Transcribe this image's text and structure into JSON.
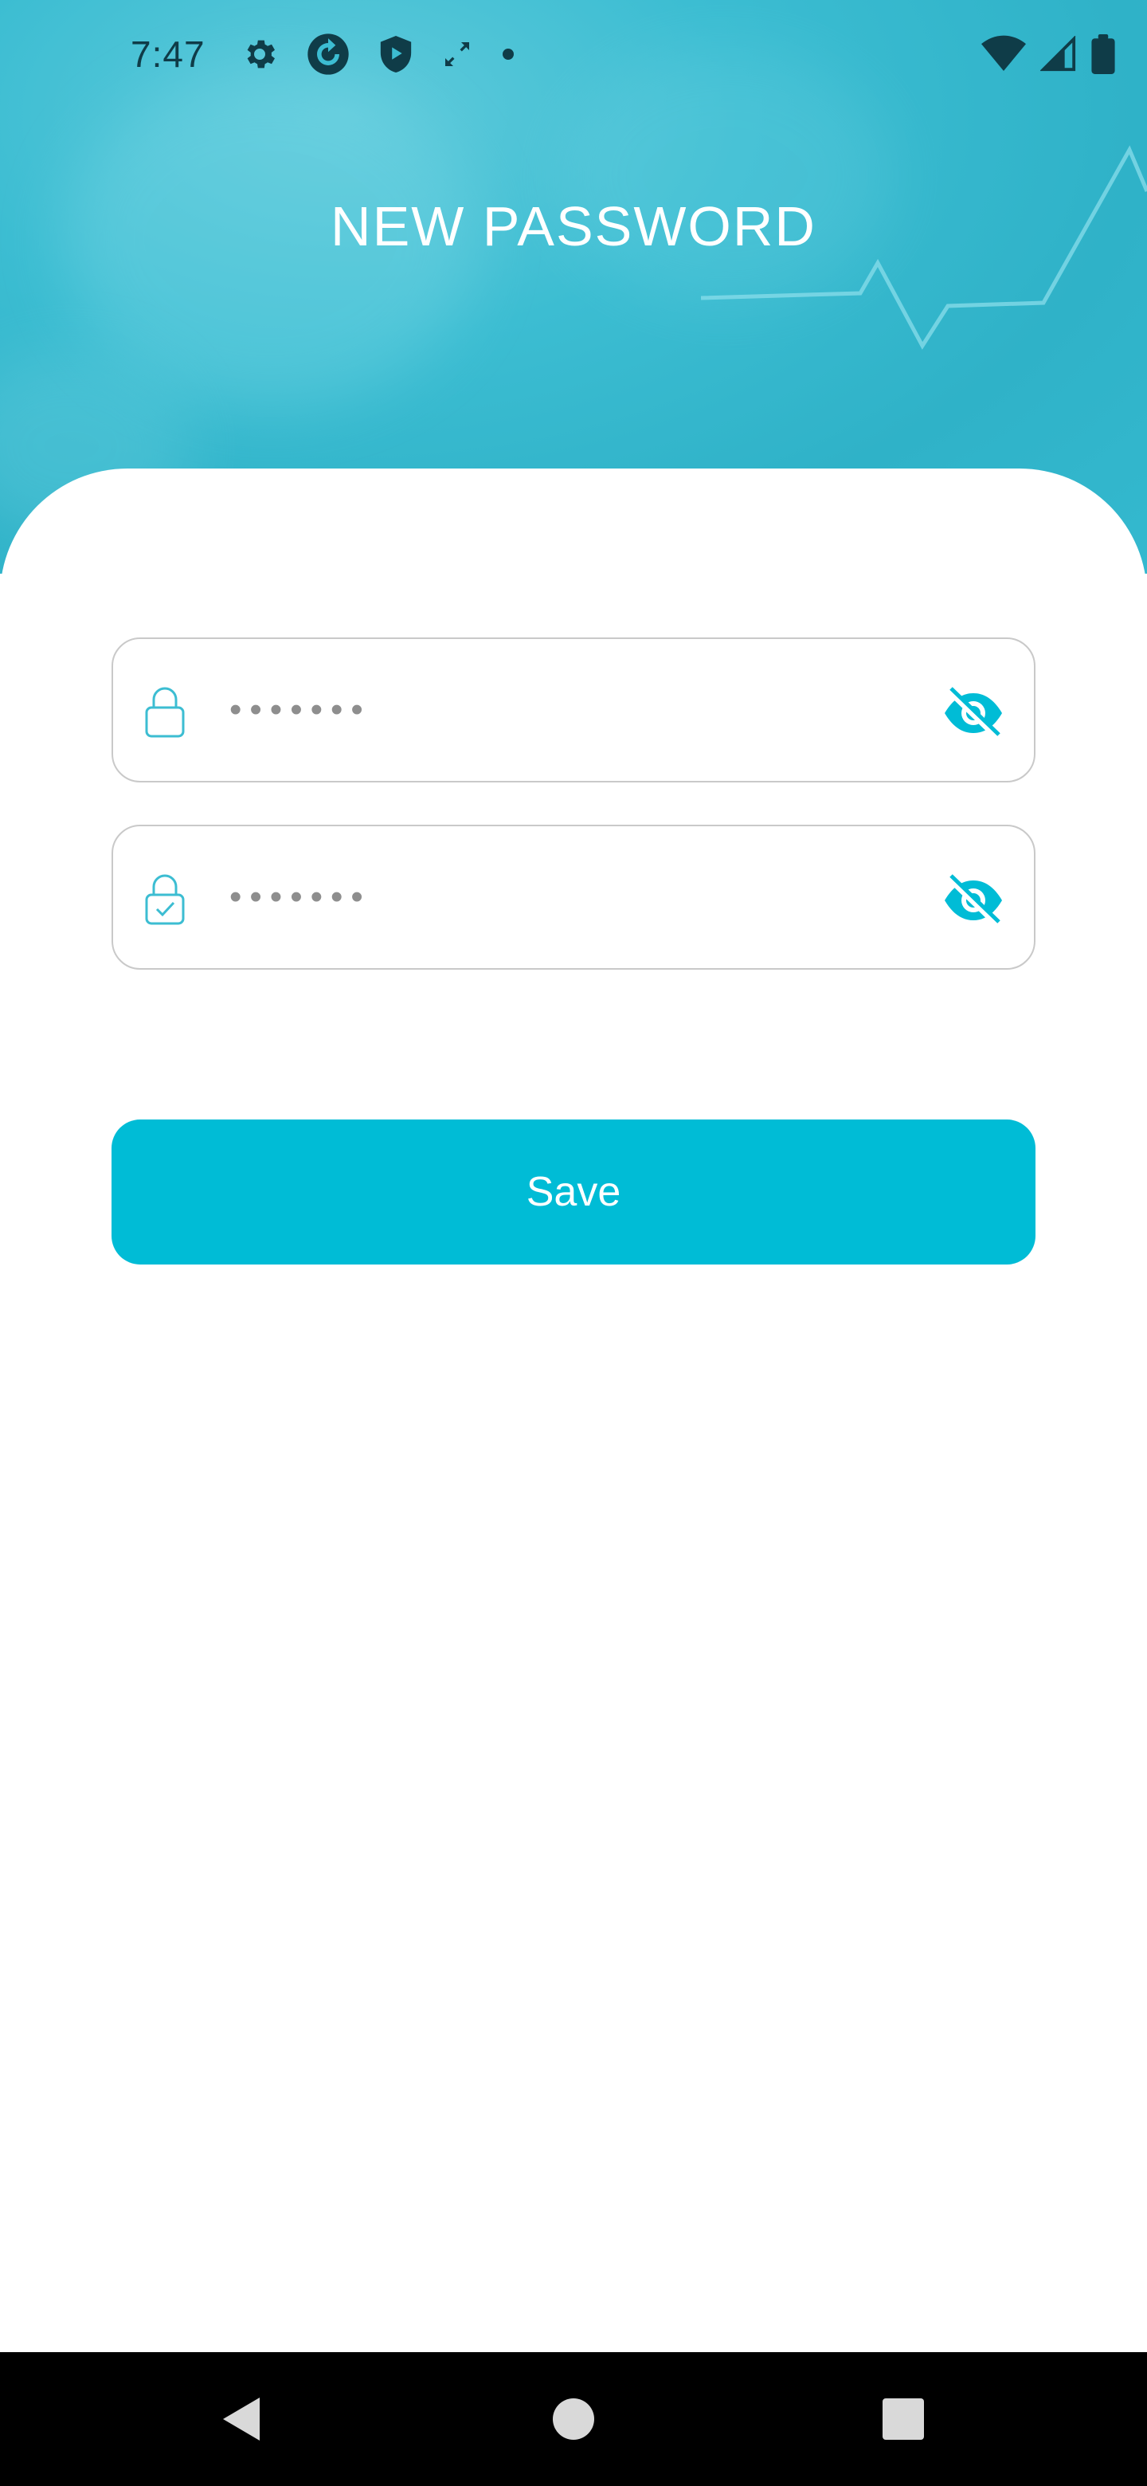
{
  "status_bar": {
    "time": "7:47",
    "icons_left": [
      "settings-gear-icon",
      "sync-circle-icon",
      "shield-play-icon",
      "expand-arrows-icon",
      "dot-icon"
    ],
    "icons_right": [
      "wifi-icon",
      "cellular-signal-icon",
      "battery-icon"
    ]
  },
  "header": {
    "title": "NEW PASSWORD"
  },
  "form": {
    "password_field": {
      "value": "•••••••",
      "lock_icon": "lock-icon",
      "visibility_icon": "eye-off-icon"
    },
    "confirm_password_field": {
      "value": "•••••••",
      "lock_icon": "lock-check-icon",
      "visibility_icon": "eye-off-icon"
    },
    "save_label": "Save"
  },
  "nav_bar": {
    "back": "back-triangle-icon",
    "home": "home-circle-icon",
    "recents": "recents-square-icon"
  },
  "colors": {
    "accent": "#00bcd6",
    "header_bg": "#3cbdd2",
    "field_border": "#c9c9c9",
    "status_icon": "#0f3c48"
  }
}
